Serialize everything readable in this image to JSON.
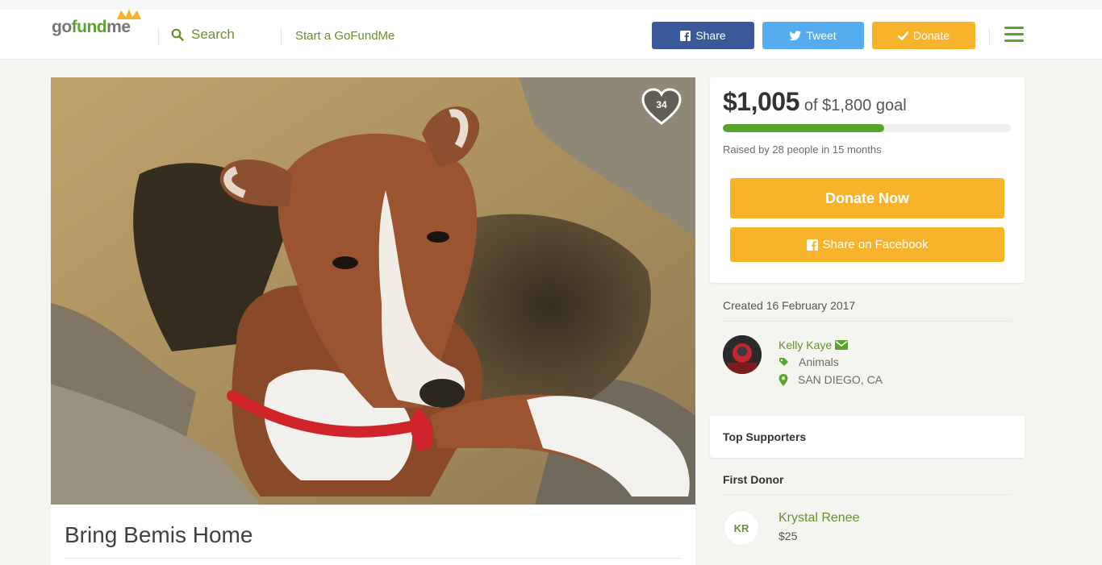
{
  "header": {
    "logo": {
      "part1": "go",
      "part2": "fund",
      "part3": "me"
    },
    "search_label": "Search",
    "start_label": "Start a GoFundMe",
    "share_label": "Share",
    "tweet_label": "Tweet",
    "donate_label": "Donate",
    "icons": [
      "search-icon",
      "facebook-icon",
      "twitter-icon",
      "check-icon",
      "menu-icon"
    ],
    "colors": {
      "brand_green": "#57a62b",
      "facebook_blue": "#3b5998",
      "twitter_blue": "#55acee",
      "donate_orange": "#f7b32b"
    }
  },
  "campaign": {
    "title": "Bring Bemis Home",
    "heart_count": "34",
    "raised": "$1,005",
    "goal_text": "of $1,800 goal",
    "progress": 0.56,
    "raised_by": "Raised by 28 people in 15 months",
    "donate_now_label": "Donate Now",
    "share_facebook_label": "Share on Facebook",
    "created": "Created 16 February 2017",
    "organizer": {
      "name": "Kelly Kaye",
      "category": "Animals",
      "location": "SAN DIEGO, CA"
    }
  },
  "supporters": {
    "heading": "Top Supporters",
    "first_donor_heading": "First Donor",
    "first_donor": {
      "initials": "KR",
      "name": "Krystal Renee",
      "amount": "$25"
    }
  }
}
